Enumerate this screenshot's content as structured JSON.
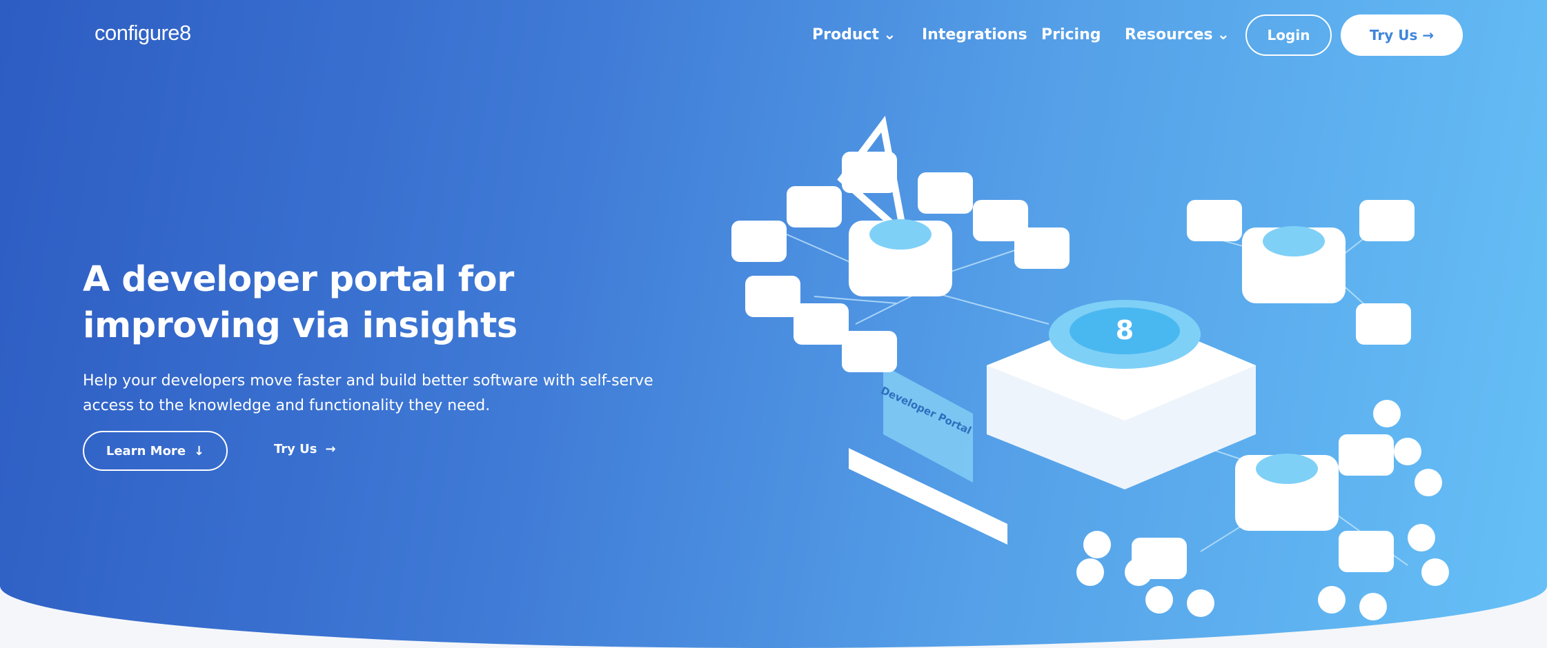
{
  "header": {
    "logo": "configure8",
    "nav": [
      {
        "label": "Product",
        "dropdown": true
      },
      {
        "label": "Integrations"
      },
      {
        "label": "Pricing"
      },
      {
        "label": "Resources",
        "dropdown": true
      }
    ],
    "login": "Login",
    "try_us": "Try Us"
  },
  "hero": {
    "title_line1": "A developer portal for",
    "title_line2": "improving via insights",
    "subtitle": "Help your developers move faster and build better software with self-serve access to the knowledge and functionality they need.",
    "learn_more": "Learn More",
    "try_us": "Try Us",
    "illustration_label": "Developer Portal"
  },
  "colors": {
    "gradient_start": "#2d5cc2",
    "gradient_end": "#66c0f6",
    "accent": "#3f86dc"
  }
}
